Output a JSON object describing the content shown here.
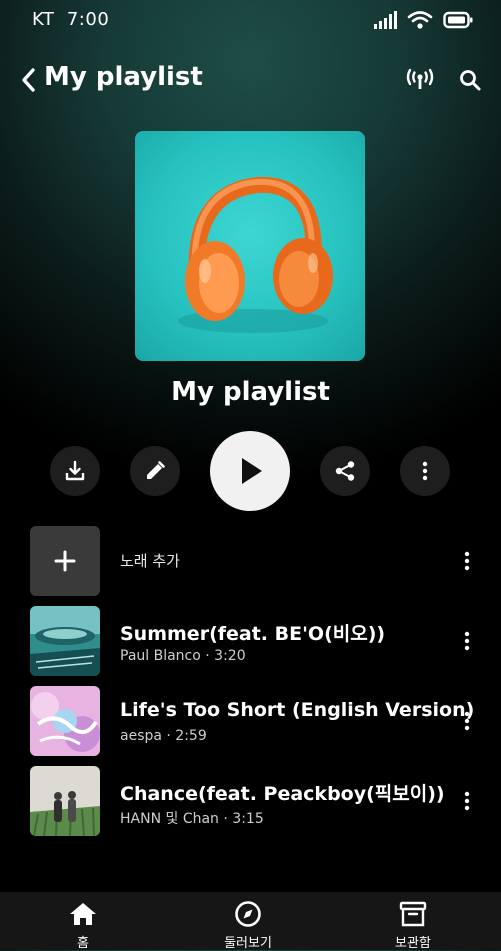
{
  "status_bar": {
    "carrier": "KT",
    "time": "7:00"
  },
  "header": {
    "title": "My playlist"
  },
  "cover": {
    "icon": "headphones-image"
  },
  "playlist": {
    "title": "My playlist"
  },
  "add_song": {
    "label": "노래 추가"
  },
  "songs": [
    {
      "title": "Summer(feat. BE'O(비오))",
      "subtitle": "Paul Blanco · 3:20"
    },
    {
      "title": "Life's Too Short (English Version)",
      "subtitle": "aespa · 2:59"
    },
    {
      "title": "Chance(feat. Peackboy(픽보이))",
      "subtitle": "HANN 및 Chan · 3:15"
    }
  ],
  "nav": [
    {
      "label": "홈",
      "icon": "home-icon"
    },
    {
      "label": "둘러보기",
      "icon": "compass-icon"
    },
    {
      "label": "보관함",
      "icon": "library-icon"
    }
  ]
}
